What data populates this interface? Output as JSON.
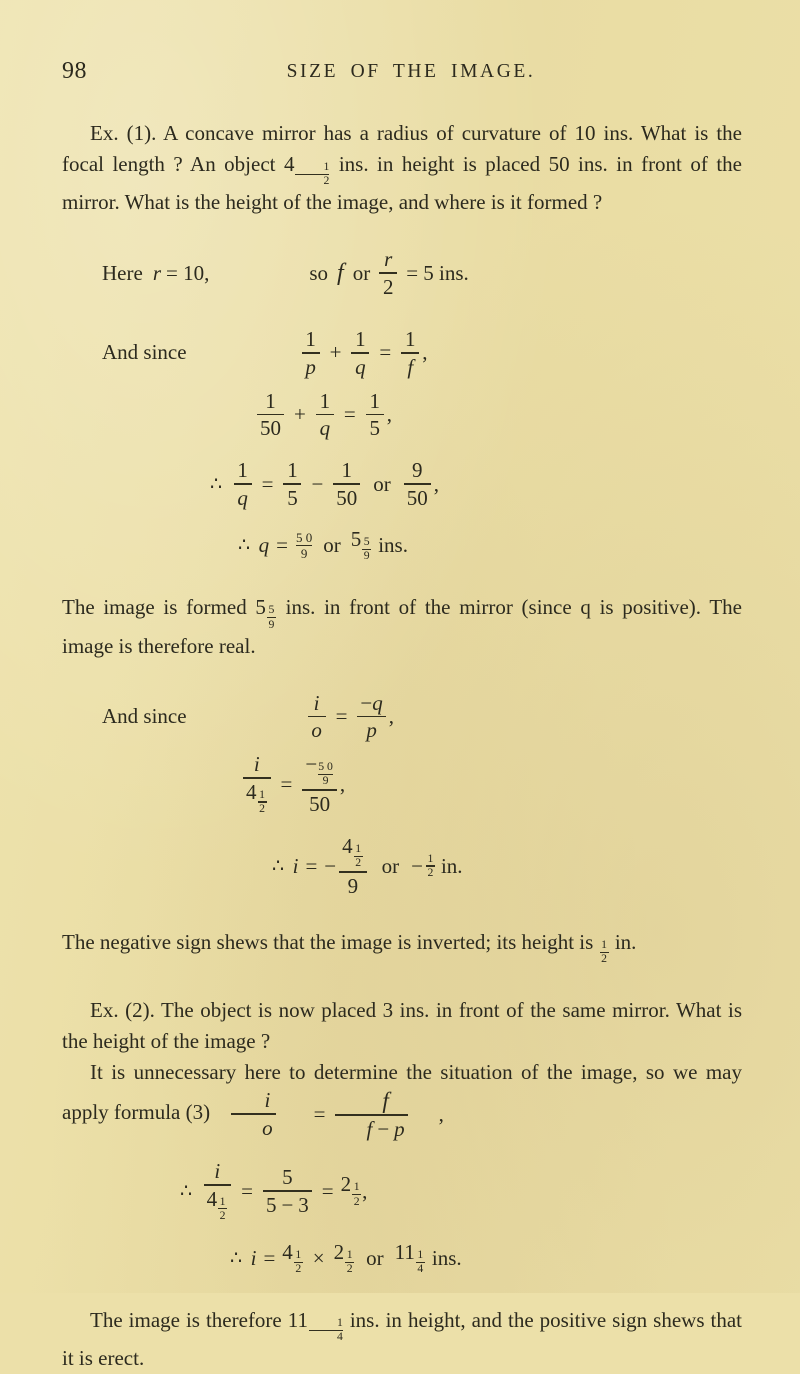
{
  "page": {
    "folio": "98",
    "running_head": "SIZE OF THE IMAGE.",
    "paper_color": "#ece0a9",
    "ink_color": "#2c2a1e"
  },
  "example_1": {
    "paragraph": "Ex. (1). A concave mirror has a radius of curvature of 10 ins. What is the focal length ? An object 4½ ins. in height is placed 50 ins. in front of the mirror. What is the height of the image, and where is it formed ?",
    "paragraph_runs": {
      "run_1": "Ex. (1).  A concave mirror has a radius of curvature of 10 ins.  What is the focal length ?  An object 4",
      "run_2": " ins. in height is placed 50 ins. in front of the mirror.  What is the height of the image, and where is it formed ?"
    },
    "given_line": {
      "lead": "Here",
      "r_symbol": "r",
      "r_equals": "= 10,",
      "so_label": "so",
      "f_symbol": "f",
      "or_label": "or",
      "numerator": "r",
      "denominator": "2",
      "result": "= 5 ins."
    },
    "and_since_label": "And since",
    "eq_general": {
      "n1": "1",
      "d1": "p",
      "plus": "+",
      "n2": "1",
      "d2": "q",
      "equals": "=",
      "n3": "1",
      "d3": "f",
      "trailer": ","
    },
    "eq_numeric": {
      "n1": "1",
      "d1": "50",
      "plus": "+",
      "n2": "1",
      "d2": "q",
      "equals": "=",
      "n3": "1",
      "d3": "5",
      "trailer": ","
    },
    "eq_solve_q": {
      "therefore": "∴",
      "n1": "1",
      "d1": "q",
      "equals": "=",
      "n2": "1",
      "d2": "5",
      "minus": "−",
      "n3": "1",
      "d3": "50",
      "or": "or",
      "n4": "9",
      "d4": "50",
      "trailer": ","
    },
    "eq_q_value": {
      "therefore": "∴",
      "q_symbol": "q",
      "equals": "=",
      "frac_num": "5 0",
      "frac_den": "9",
      "or": "or",
      "whole": "5",
      "mixed_num": "5",
      "mixed_den": "9",
      "unit": "ins."
    },
    "conclusion_paragraph": {
      "run_1": "The image is formed 5",
      "run_2": " ins. in front of the mirror (since q is positive).  The image is therefore real."
    },
    "eq_magnification": {
      "label": "And since",
      "n1": "i",
      "d1": "o",
      "equals": "=",
      "sign": "−",
      "n2": "q",
      "d2": "p",
      "trailer": ","
    },
    "eq_magnification_numeric": {
      "n1": "i",
      "d1_whole": "4",
      "d1_num": "1",
      "d1_den": "2",
      "equals": "=",
      "sign": "−",
      "n2_num": "5 0",
      "n2_den": "9",
      "d2": "50",
      "trailer": ","
    },
    "eq_i_value": {
      "therefore": "∴",
      "i_symbol": "i",
      "equals": "=",
      "sign": "−",
      "num_whole": "4",
      "num_fnum": "1",
      "num_fden": "2",
      "den": "9",
      "or": "or",
      "sign2": "−",
      "result_num": "1",
      "result_den": "2",
      "unit": "in."
    },
    "final_paragraph": {
      "run_1": "The negative sign shews that the image is inverted; its height is ",
      "run_2_num": "1",
      "run_2_den": "2",
      "run_3": " in."
    }
  },
  "example_2": {
    "paragraph_run_1": "Ex. (2).  The object is now placed 3 ins. in front of the same mirror.  What is the height of the image ?",
    "paragraph_run_2": "It is unnecessary here to determine the situation of the image, so we may apply formula (3)",
    "formula_3": {
      "n1": "i",
      "d1": "o",
      "equals": "=",
      "num": "f",
      "den_left": "f",
      "den_minus": "−",
      "den_right": "p",
      "trailer": ","
    },
    "eq_substitute": {
      "therefore": "∴",
      "n1": "i",
      "d1_whole": "4",
      "d1_num": "1",
      "d1_den": "2",
      "equals1": "=",
      "n2": "5",
      "d2_left": "5",
      "d2_minus": "−",
      "d2_right": "3",
      "equals2": "=",
      "res_whole": "2",
      "res_num": "1",
      "res_den": "2",
      "trailer": ","
    },
    "eq_result": {
      "therefore": "∴",
      "i_symbol": "i",
      "equals": "=",
      "a_whole": "4",
      "a_num": "1",
      "a_den": "2",
      "times": "×",
      "b_whole": "2",
      "b_num": "1",
      "b_den": "2",
      "or": "or",
      "c_whole": "11",
      "c_num": "1",
      "c_den": "4",
      "unit": "ins."
    },
    "closing_paragraph": {
      "run_1": "The image is therefore 11",
      "run_2_num": "1",
      "run_2_den": "4",
      "run_3": " ins. in height, and the positive sign shews that it is erect."
    }
  }
}
